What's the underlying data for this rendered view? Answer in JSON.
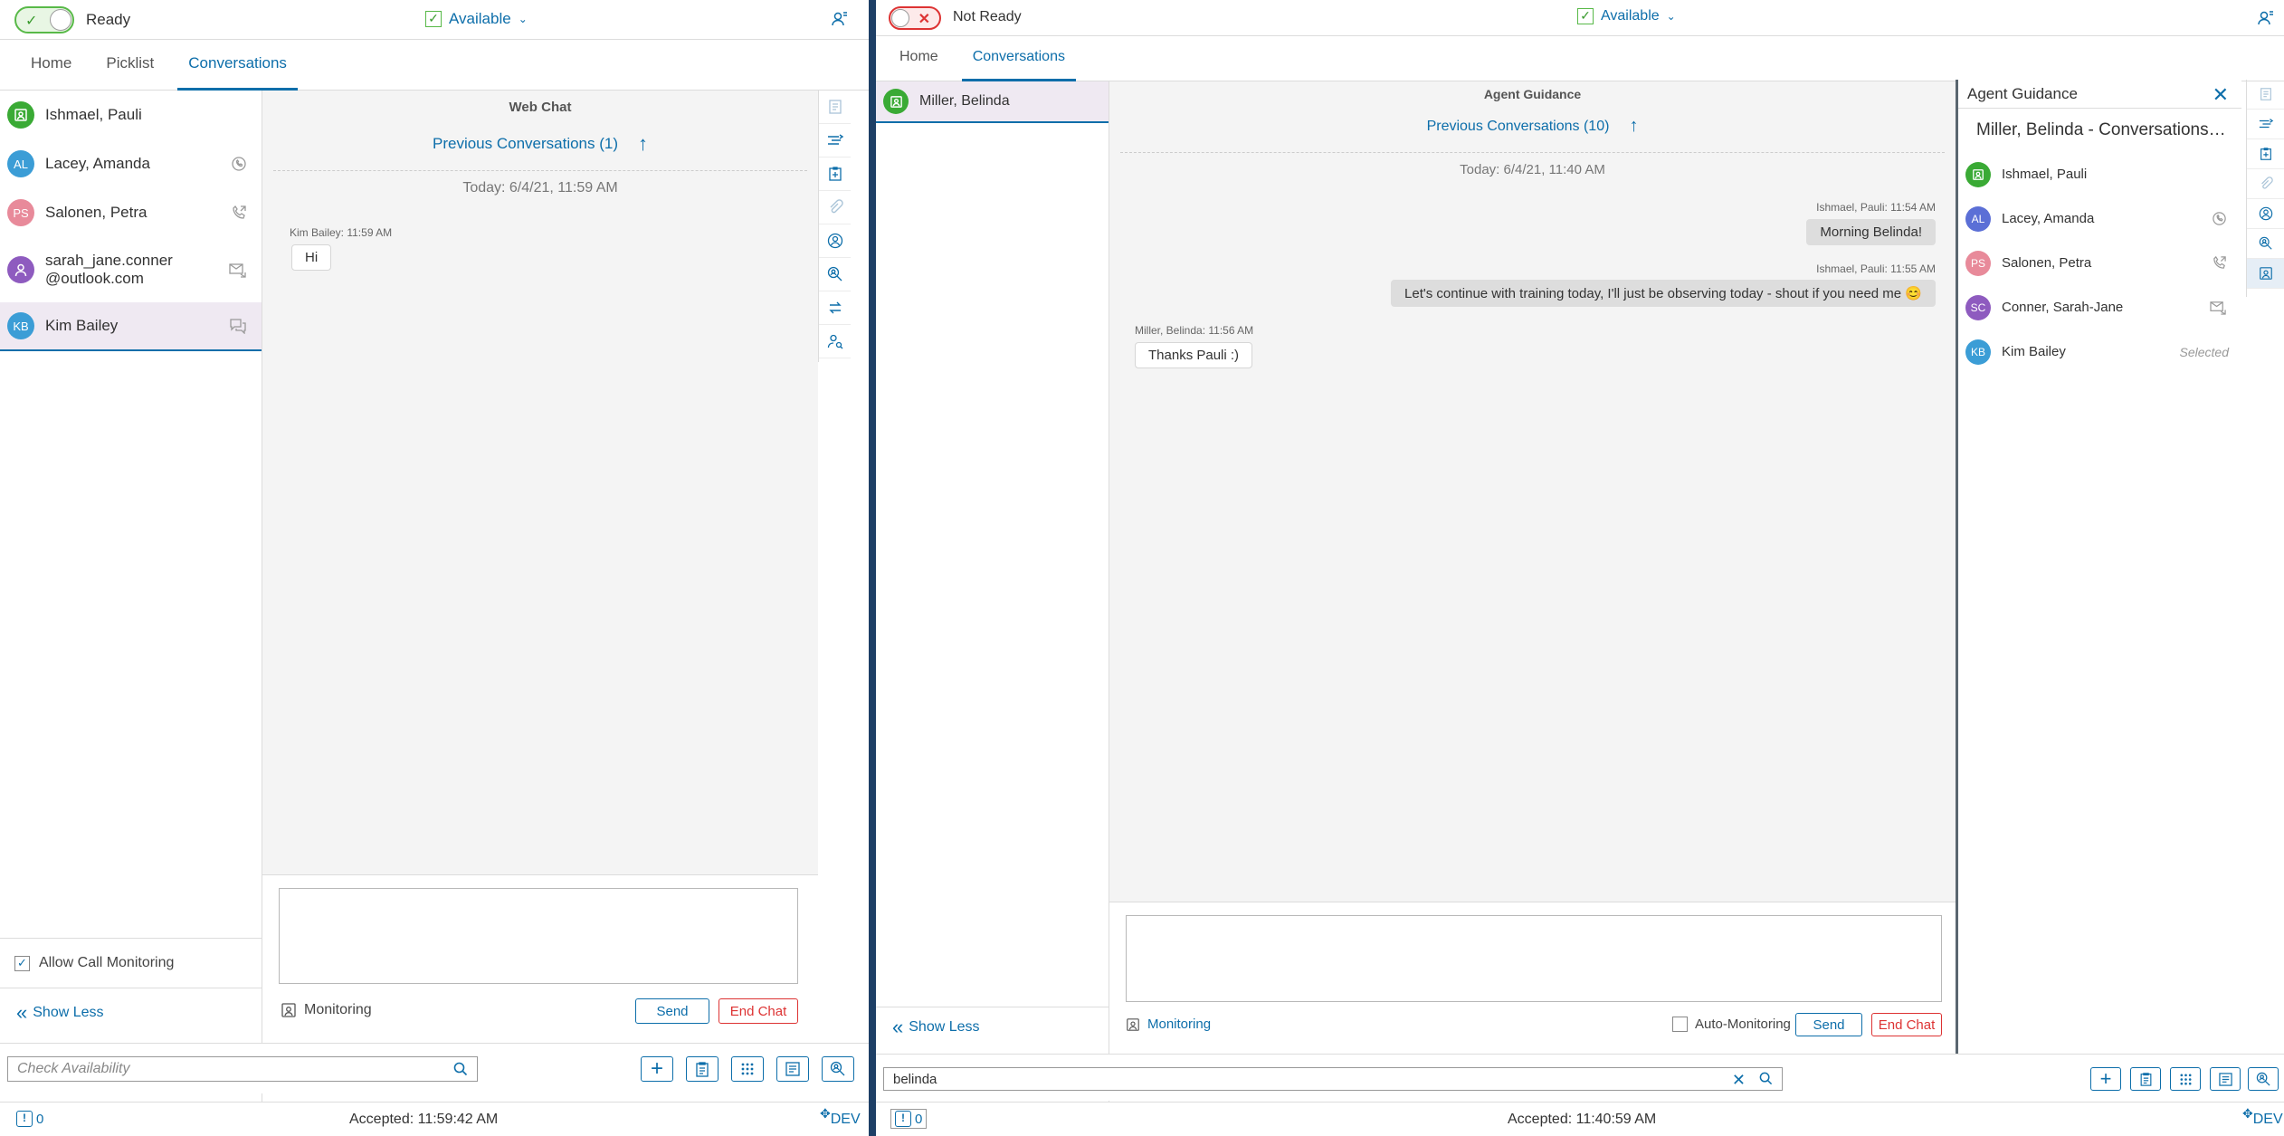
{
  "colors": {
    "accent": "#0d6eaa",
    "ready_green": "#58b948",
    "danger": "#dd3333",
    "avatar_green": "#3aaa35",
    "avatar_blue": "#3b9dd6",
    "avatar_pink": "#e88a9a",
    "avatar_purple": "#8e5bbf",
    "avatar_indigo": "#5b6fd6"
  },
  "left": {
    "state": "Ready",
    "availability": "Available",
    "tabs": [
      "Home",
      "Picklist",
      "Conversations"
    ],
    "active_tab": "Conversations",
    "conversations": [
      {
        "name": "Ishmael, Pauli",
        "initials": "",
        "icon": "monitor-icon",
        "type_icon": ""
      },
      {
        "name": "Lacey, Amanda",
        "initials": "AL",
        "type_icon": "voice-icon"
      },
      {
        "name": "Salonen, Petra",
        "initials": "PS",
        "type_icon": "outbound-call-icon"
      },
      {
        "name": "sarah_jane.conner\n@outlook.com",
        "initials": "",
        "icon": "person-icon",
        "type_icon": "email-icon"
      },
      {
        "name": "Kim Bailey",
        "initials": "KB",
        "type_icon": "chat-icon"
      }
    ],
    "allow_call_monitoring": "Allow Call Monitoring",
    "show_less": "Show Less",
    "chat": {
      "title": "Web Chat",
      "previous": "Previous Conversations (1)",
      "today": "Today: 6/4/21, 11:59 AM",
      "messages": [
        {
          "meta": "Kim Bailey: 11:59 AM",
          "text": "Hi"
        }
      ]
    },
    "monitoring": "Monitoring",
    "send": "Send",
    "end_chat": "End Chat",
    "search_placeholder": "Check Availability",
    "alert_count": "0",
    "accepted": "Accepted: 11:59:42 AM",
    "env": "DEV"
  },
  "right": {
    "state": "Not Ready",
    "availability": "Available",
    "tabs": [
      "Home",
      "Conversations"
    ],
    "active_tab": "Conversations",
    "conversations": [
      {
        "name": "Miller, Belinda"
      }
    ],
    "show_less": "Show Less",
    "chat": {
      "title": "Agent Guidance",
      "previous": "Previous Conversations (10)",
      "today": "Today: 6/4/21, 11:40 AM",
      "messages": [
        {
          "meta": "Ishmael, Pauli: 11:54 AM",
          "text": "Morning Belinda!",
          "dir": "out"
        },
        {
          "meta": "Ishmael, Pauli: 11:55 AM",
          "text": "Let's continue with training today, I'll just be observing today - shout if you need me 😊",
          "dir": "out"
        },
        {
          "meta": "Miller, Belinda: 11:56 AM",
          "text": "Thanks Pauli :)",
          "dir": "in"
        }
      ]
    },
    "monitoring": "Monitoring",
    "auto_monitoring": "Auto-Monitoring",
    "send": "Send",
    "end_chat": "End Chat",
    "search_value": "belinda",
    "alert_count": "0",
    "accepted": "Accepted: 11:40:59 AM",
    "env": "DEV",
    "guidance": {
      "header": "Agent Guidance",
      "title": "Miller, Belinda - Conversations…",
      "items": [
        {
          "name": "Ishmael, Pauli",
          "initials": ""
        },
        {
          "name": "Lacey, Amanda",
          "initials": "AL"
        },
        {
          "name": "Salonen, Petra",
          "initials": "PS"
        },
        {
          "name": "Conner, Sarah-Jane",
          "initials": "SC"
        },
        {
          "name": "Kim Bailey",
          "initials": "KB",
          "selected": "Selected"
        }
      ]
    }
  }
}
